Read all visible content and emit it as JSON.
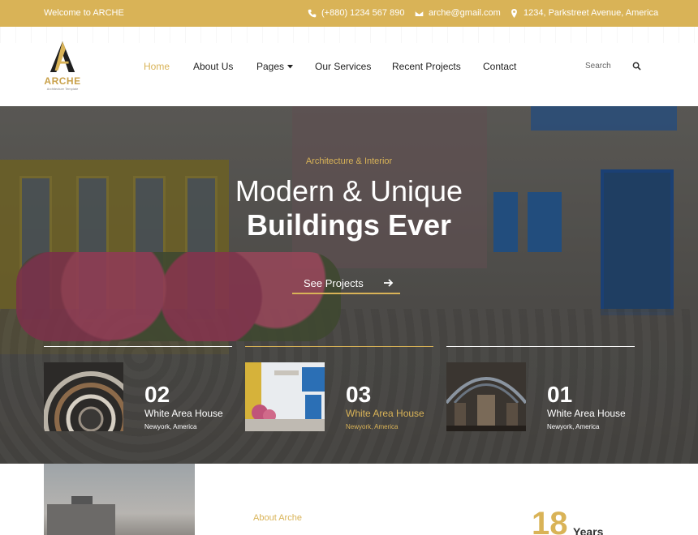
{
  "topbar": {
    "welcome": "Welcome to ARCHE",
    "phone": "(+880) 1234 567 890",
    "email": "arche@gmail.com",
    "address": "1234, Parkstreet Avenue, America"
  },
  "brand": {
    "name": "ARCHE",
    "tagline": "Architecture Template",
    "accent": "#d9b357"
  },
  "nav": {
    "items": [
      {
        "label": "Home",
        "active": true
      },
      {
        "label": "About Us"
      },
      {
        "label": "Pages"
      },
      {
        "label": "Our Services"
      },
      {
        "label": "Recent Projects"
      },
      {
        "label": "Contact"
      }
    ],
    "search_label": "Search"
  },
  "hero": {
    "subtitle": "Architecture & Interior",
    "title_line1": "Modern & Unique",
    "title_line2": "Buildings Ever",
    "cta": "See Projects"
  },
  "projects": [
    {
      "number": "02",
      "name": "White Area House",
      "location": "Newyork, America"
    },
    {
      "number": "03",
      "name": "White Area House",
      "location": "Newyork, America",
      "active": true
    },
    {
      "number": "01",
      "name": "White Area House",
      "location": "Newyork, America"
    }
  ],
  "about": {
    "label": "About Arche",
    "years_number": "18",
    "years_label": "Years"
  }
}
